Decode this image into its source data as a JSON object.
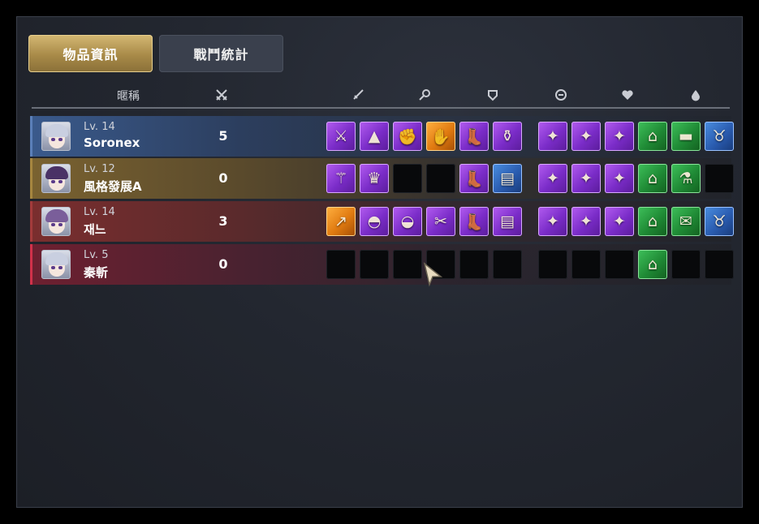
{
  "tabs": [
    {
      "label": "物品資訊",
      "active": true
    },
    {
      "label": "戰鬥統計",
      "active": false
    }
  ],
  "header": {
    "name_label": "暱稱",
    "icons": [
      "crossed-swords-icon",
      "weapon-icon",
      "accessory-icon",
      "armor-icon",
      "skill-card-icon",
      "heart-icon",
      "potion-icon"
    ]
  },
  "rows": [
    {
      "level": "Lv. 14",
      "name": "Soronex",
      "kills": "5",
      "theme": "blue",
      "slots": [
        {
          "rarity": "purple",
          "icon": "sword-icon"
        },
        {
          "rarity": "purple",
          "icon": "witch-hat-icon"
        },
        {
          "rarity": "purple",
          "icon": "gauntlet-icon"
        },
        {
          "rarity": "orange",
          "icon": "glove-icon"
        },
        {
          "rarity": "purple",
          "icon": "boots-icon"
        },
        {
          "rarity": "purple",
          "icon": "bottle-icon"
        },
        {
          "rarity": "purple",
          "icon": "skill-card-icon"
        },
        {
          "rarity": "purple",
          "icon": "skill-card-icon"
        },
        {
          "rarity": "purple",
          "icon": "skill-card-icon"
        },
        {
          "rarity": "green",
          "icon": "hat-icon"
        },
        {
          "rarity": "green",
          "icon": "log-icon"
        },
        {
          "rarity": "blue",
          "icon": "bull-head-icon"
        }
      ]
    },
    {
      "level": "Lv. 12",
      "name": "風格發展A",
      "kills": "0",
      "theme": "gold",
      "slots": [
        {
          "rarity": "purple",
          "icon": "staff-icon"
        },
        {
          "rarity": "purple",
          "icon": "crown-icon"
        },
        {
          "rarity": "empty",
          "icon": ""
        },
        {
          "rarity": "empty",
          "icon": ""
        },
        {
          "rarity": "purple",
          "icon": "boots-icon"
        },
        {
          "rarity": "blue",
          "icon": "book-icon"
        },
        {
          "rarity": "purple",
          "icon": "skill-card-icon"
        },
        {
          "rarity": "purple",
          "icon": "skill-card-icon"
        },
        {
          "rarity": "purple",
          "icon": "skill-card-icon"
        },
        {
          "rarity": "green",
          "icon": "hat-icon"
        },
        {
          "rarity": "green",
          "icon": "flask-icon"
        },
        {
          "rarity": "empty",
          "icon": ""
        }
      ]
    },
    {
      "level": "Lv. 14",
      "name": "재느",
      "kills": "3",
      "theme": "red",
      "slots": [
        {
          "rarity": "orange",
          "icon": "spear-icon"
        },
        {
          "rarity": "purple",
          "icon": "hood-icon"
        },
        {
          "rarity": "purple",
          "icon": "helmet-icon"
        },
        {
          "rarity": "purple",
          "icon": "claw-icon"
        },
        {
          "rarity": "purple",
          "icon": "boots-icon"
        },
        {
          "rarity": "purple",
          "icon": "book-icon"
        },
        {
          "rarity": "purple",
          "icon": "skill-card-icon"
        },
        {
          "rarity": "purple",
          "icon": "skill-card-icon"
        },
        {
          "rarity": "purple",
          "icon": "skill-card-icon"
        },
        {
          "rarity": "green",
          "icon": "hat-icon"
        },
        {
          "rarity": "green",
          "icon": "scroll-icon"
        },
        {
          "rarity": "blue",
          "icon": "bull-head-icon"
        }
      ]
    },
    {
      "level": "Lv. 5",
      "name": "秦斬",
      "kills": "0",
      "theme": "crimson",
      "slots": [
        {
          "rarity": "empty",
          "icon": ""
        },
        {
          "rarity": "empty",
          "icon": ""
        },
        {
          "rarity": "empty",
          "icon": ""
        },
        {
          "rarity": "empty",
          "icon": ""
        },
        {
          "rarity": "empty",
          "icon": ""
        },
        {
          "rarity": "empty",
          "icon": ""
        },
        {
          "rarity": "empty",
          "icon": ""
        },
        {
          "rarity": "empty",
          "icon": ""
        },
        {
          "rarity": "empty",
          "icon": ""
        },
        {
          "rarity": "green",
          "icon": "hat-icon"
        },
        {
          "rarity": "empty",
          "icon": ""
        },
        {
          "rarity": "empty",
          "icon": ""
        }
      ]
    }
  ],
  "colors": {
    "tab_active": "#c9ab62",
    "tab_inactive": "#3a404d",
    "rarity_purple": "#8a3ad8",
    "rarity_orange": "#e88a1a",
    "rarity_green": "#229a3c",
    "rarity_blue": "#2f63b8"
  }
}
